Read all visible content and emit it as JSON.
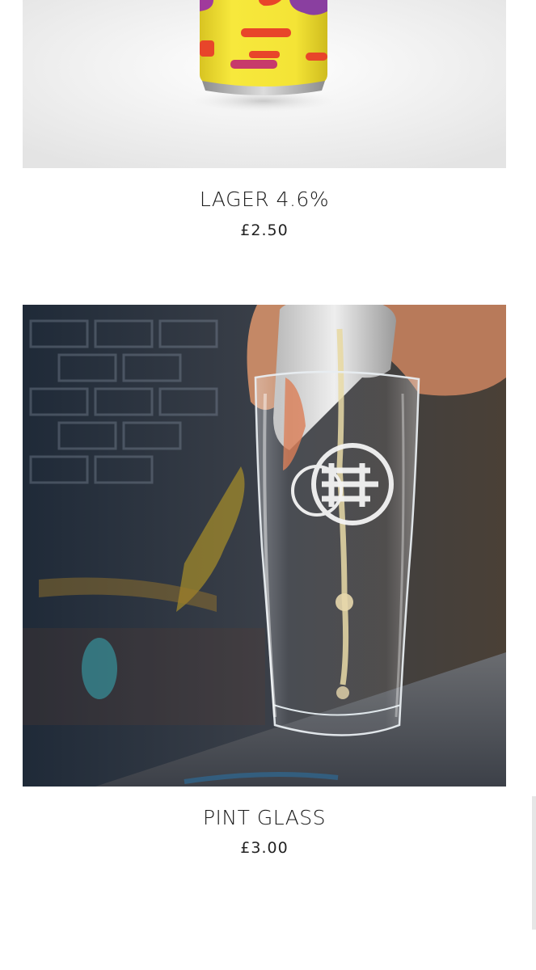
{
  "products": [
    {
      "title": "LAGER 4.6%",
      "price": "£2.50",
      "image": "lager-can-image"
    },
    {
      "title": "PINT GLASS",
      "price": "£3.00",
      "image": "pint-glass-image"
    }
  ],
  "colors": {
    "can_yellow": "#f2e23a",
    "can_stripe": "#e8452a",
    "can_purple": "#8a3fa0",
    "brick_dark": "#2b3644",
    "bar_top": "#5a5e66"
  }
}
